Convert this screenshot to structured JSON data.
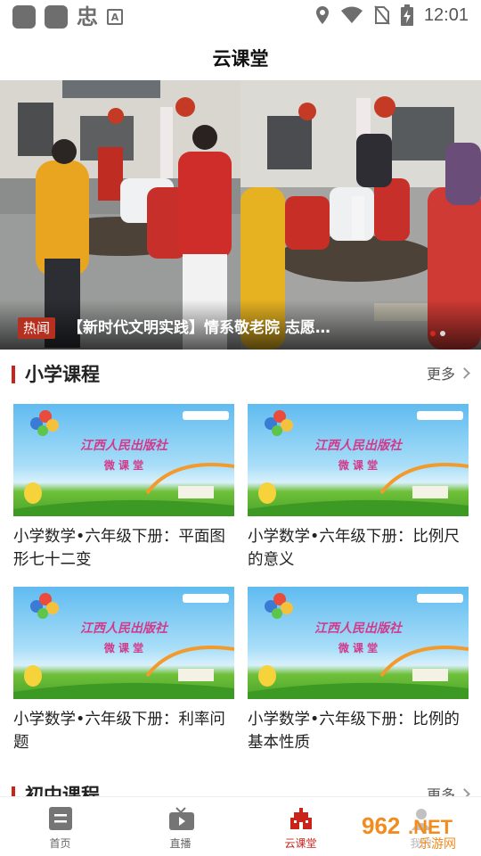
{
  "status_bar": {
    "time": "12:01",
    "notif_glyph": "忠",
    "icons": [
      "app-square-icon",
      "app-square-icon",
      "a-box-icon",
      "location-icon",
      "wifi-icon",
      "no-sim-icon",
      "battery-charging-icon"
    ]
  },
  "header": {
    "title": "云课堂"
  },
  "banner": {
    "tag": "热闻",
    "caption": "【新时代文明实践】情系敬老院 志愿…",
    "slide_count": 2,
    "active_slide": 1
  },
  "sections": [
    {
      "title": "小学课程",
      "more": "更多",
      "cards": [
        {
          "title": "小学数学•六年级下册：平面图形七十二变",
          "thumb_line1": "江西人民出版社",
          "thumb_line2": "微 课 堂"
        },
        {
          "title": "小学数学•六年级下册：比例尺的意义",
          "thumb_line1": "江西人民出版社",
          "thumb_line2": "微 课 堂"
        },
        {
          "title": "小学数学•六年级下册：利率问题",
          "thumb_line1": "江西人民出版社",
          "thumb_line2": "微 课 堂"
        },
        {
          "title": "小学数学•六年级下册：比例的基本性质",
          "thumb_line1": "江西人民出版社",
          "thumb_line2": "微 课 堂"
        }
      ]
    },
    {
      "title": "初中课程",
      "more": "更多"
    }
  ],
  "bottom_nav": {
    "items": [
      {
        "label": "首页",
        "icon": "home-doc-icon"
      },
      {
        "label": "直播",
        "icon": "tv-icon"
      },
      {
        "label": "云课堂",
        "icon": "school-building-icon"
      },
      {
        "label": "我的",
        "icon": "user-icon"
      }
    ],
    "active": 2
  },
  "watermark": {
    "text": "962.NET",
    "sub": "乐游网"
  },
  "colors": {
    "accent": "#c8241a",
    "tag_bg": "#b5301f"
  }
}
